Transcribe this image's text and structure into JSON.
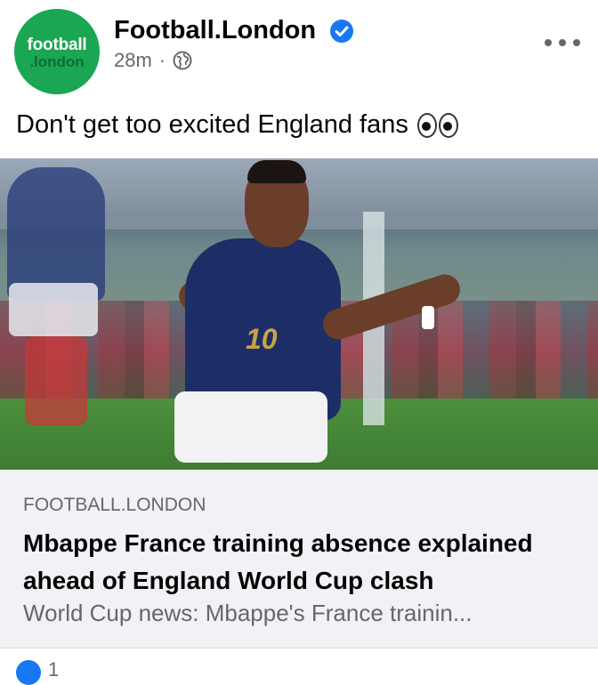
{
  "post": {
    "avatar": {
      "line1": "football",
      "line2": ".london"
    },
    "page_name": "Football.London",
    "time": "28m",
    "separator": "·",
    "caption": "Don't get too excited England fans"
  },
  "image": {
    "jersey_number": "10"
  },
  "link": {
    "domain": "FOOTBALL.LONDON",
    "title": "Mbappe France training absence explained ahead of England World Cup clash",
    "description": "World Cup news: Mbappe's France trainin..."
  },
  "reactions": {
    "count": "1"
  },
  "colors": {
    "brand_green": "#1aa653",
    "verified_blue": "#1877f2",
    "link_bg": "#f0f2f5",
    "meta_gray": "#65676b"
  },
  "icons": [
    "verified-badge-icon",
    "globe-icon",
    "more-options-icon",
    "eyes-emoji-icon",
    "like-reaction-icon"
  ]
}
